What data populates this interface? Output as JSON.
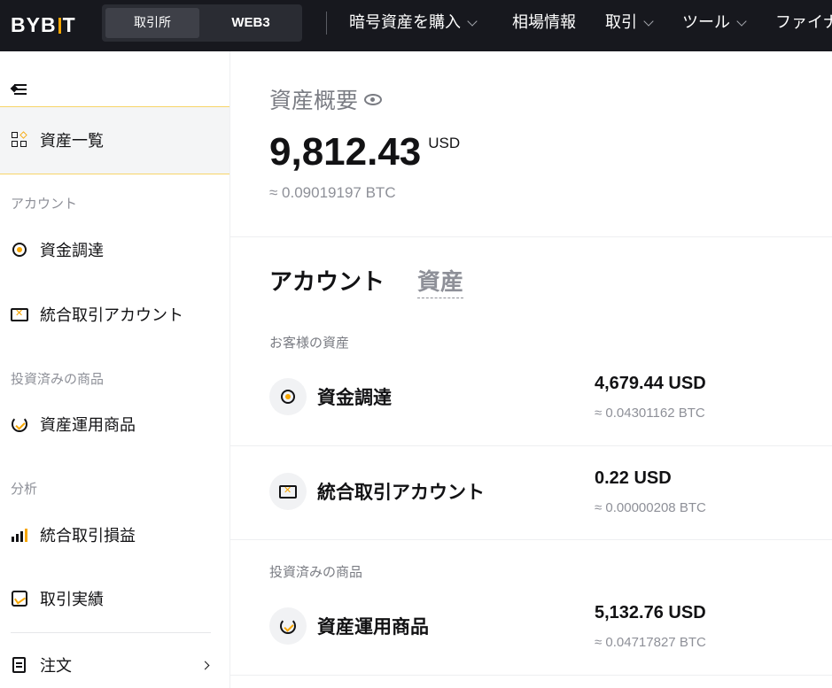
{
  "brand": {
    "logo_left": "BYB",
    "logo_right": "T",
    "accent": "#f7a600"
  },
  "header": {
    "segments": [
      "取引所",
      "WEB3"
    ],
    "nav": [
      {
        "label": "暗号資産を購入",
        "dropdown": true
      },
      {
        "label": "相場情報",
        "dropdown": false
      },
      {
        "label": "取引",
        "dropdown": true
      },
      {
        "label": "ツール",
        "dropdown": true
      },
      {
        "label": "ファイナ",
        "dropdown": false
      }
    ]
  },
  "sidebar": {
    "active_item": "資産一覧",
    "sections": [
      {
        "title": "アカウント",
        "items": [
          "資金調達",
          "統合取引アカウント"
        ]
      },
      {
        "title": "投資済みの商品",
        "items": [
          "資産運用商品"
        ]
      },
      {
        "title": "分析",
        "items": [
          "統合取引損益",
          "取引実績"
        ]
      }
    ],
    "orders": "注文"
  },
  "overview": {
    "title": "資産概要",
    "total": "9,812.43",
    "currency": "USD",
    "btc": "≈ 0.09019197 BTC"
  },
  "tabs": [
    "アカウント",
    "資産"
  ],
  "groups": [
    {
      "label": "お客様の資産",
      "accounts": [
        {
          "name": "資金調達",
          "usd": "4,679.44 USD",
          "btc": "≈ 0.04301162 BTC",
          "icon": "funding-icon"
        },
        {
          "name": "統合取引アカウント",
          "usd": "0.22 USD",
          "btc": "≈ 0.00000208 BTC",
          "icon": "unified-trading-icon"
        }
      ]
    },
    {
      "label": "投資済みの商品",
      "accounts": [
        {
          "name": "資産運用商品",
          "usd": "5,132.76 USD",
          "btc": "≈ 0.04717827 BTC",
          "icon": "earn-icon"
        }
      ]
    }
  ]
}
